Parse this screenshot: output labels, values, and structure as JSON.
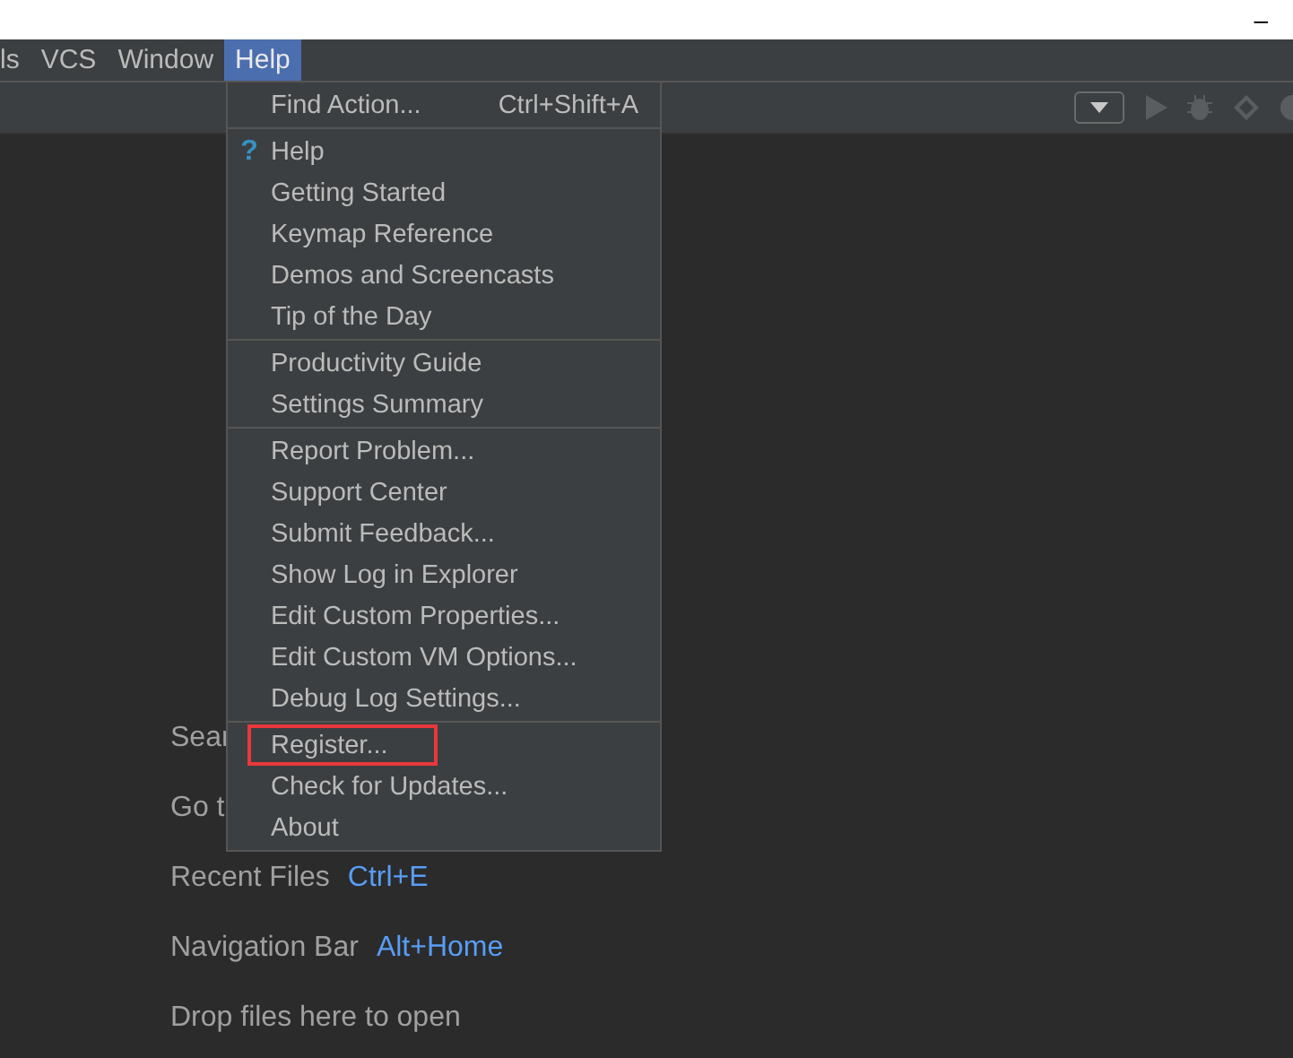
{
  "title_bar": {
    "minimize": "–"
  },
  "menu_bar": [
    {
      "label": "ls",
      "selected": false
    },
    {
      "label": "VCS",
      "selected": false
    },
    {
      "label": "Window",
      "selected": false
    },
    {
      "label": "Help",
      "selected": true
    }
  ],
  "help_menu": {
    "sections": [
      [
        {
          "label": "Find Action...",
          "shortcut": "Ctrl+Shift+A",
          "highlighted": false
        }
      ],
      [
        {
          "label": "Help",
          "icon": "?",
          "highlighted": false
        },
        {
          "label": "Getting Started",
          "highlighted": false
        },
        {
          "label": "Keymap Reference",
          "highlighted": false
        },
        {
          "label": "Demos and Screencasts",
          "highlighted": false
        },
        {
          "label": "Tip of the Day",
          "highlighted": false
        }
      ],
      [
        {
          "label": "Productivity Guide",
          "highlighted": false
        },
        {
          "label": "Settings Summary",
          "highlighted": false
        }
      ],
      [
        {
          "label": "Report Problem...",
          "highlighted": false
        },
        {
          "label": "Support Center",
          "highlighted": false
        },
        {
          "label": "Submit Feedback...",
          "highlighted": false
        },
        {
          "label": "Show Log in Explorer",
          "highlighted": false
        },
        {
          "label": "Edit Custom Properties...",
          "highlighted": false
        },
        {
          "label": "Edit Custom VM Options...",
          "highlighted": false
        },
        {
          "label": "Debug Log Settings...",
          "highlighted": false
        }
      ],
      [
        {
          "label": "Register...",
          "highlighted": true
        },
        {
          "label": "Check for Updates...",
          "highlighted": false
        },
        {
          "label": "About",
          "highlighted": false
        }
      ]
    ]
  },
  "hints": [
    {
      "label": "Sear"
    },
    {
      "label": "Go t"
    },
    {
      "label": "Recent Files",
      "shortcut": "Ctrl+E"
    },
    {
      "label": "Navigation Bar",
      "shortcut": "Alt+Home"
    },
    {
      "label": "Drop files here to open"
    }
  ]
}
